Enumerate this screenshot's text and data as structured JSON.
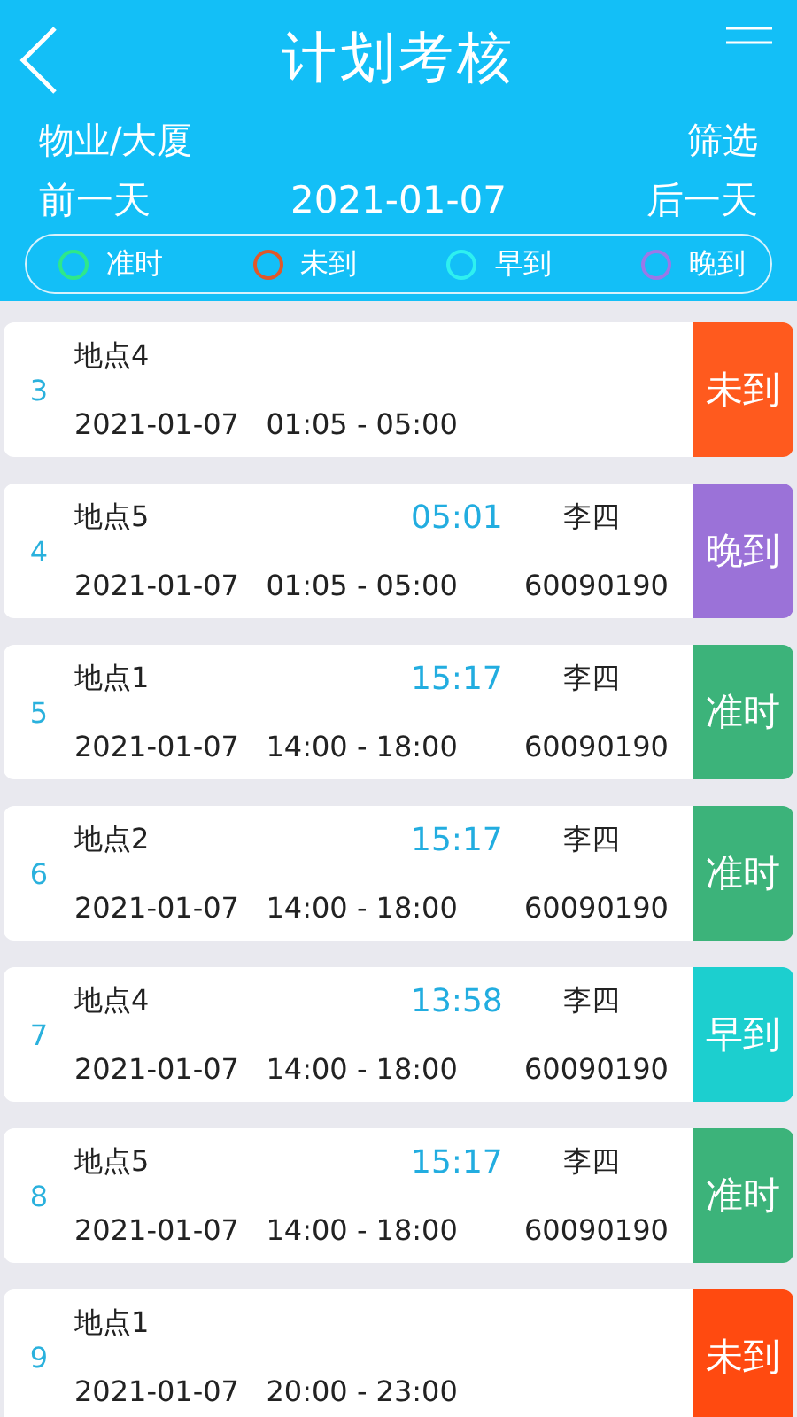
{
  "header": {
    "title": "计划考核",
    "location": "物业/大厦",
    "filter": "筛选",
    "prev_day": "前一天",
    "date": "2021-01-07",
    "next_day": "后一天"
  },
  "legend": [
    {
      "label": "准时",
      "color": "#2ee88a"
    },
    {
      "label": "未到",
      "color": "#e0582a"
    },
    {
      "label": "早到",
      "color": "#2ef0f0"
    },
    {
      "label": "晚到",
      "color": "#9a78e8"
    }
  ],
  "rows": [
    {
      "index": "3",
      "place": "地点4",
      "date": "2021-01-07",
      "range": "01:05 - 05:00",
      "status": "未到",
      "color": "#ff5a1e"
    },
    {
      "index": "4",
      "place": "地点5",
      "time": "05:01",
      "person": "李四",
      "id": "60090190",
      "date": "2021-01-07",
      "range": "01:05 - 05:00",
      "status": "晚到",
      "color": "#9b72d8"
    },
    {
      "index": "5",
      "place": "地点1",
      "time": "15:17",
      "person": "李四",
      "id": "60090190",
      "date": "2021-01-07",
      "range": "14:00 - 18:00",
      "status": "准时",
      "color": "#3cb37a"
    },
    {
      "index": "6",
      "place": "地点2",
      "time": "15:17",
      "person": "李四",
      "id": "60090190",
      "date": "2021-01-07",
      "range": "14:00 - 18:00",
      "status": "准时",
      "color": "#3cb37a"
    },
    {
      "index": "7",
      "place": "地点4",
      "time": "13:58",
      "person": "李四",
      "id": "60090190",
      "date": "2021-01-07",
      "range": "14:00 - 18:00",
      "status": "早到",
      "color": "#1ccfcf"
    },
    {
      "index": "8",
      "place": "地点5",
      "time": "15:17",
      "person": "李四",
      "id": "60090190",
      "date": "2021-01-07",
      "range": "14:00 - 18:00",
      "status": "准时",
      "color": "#3cb37a"
    },
    {
      "index": "9",
      "place": "地点1",
      "date": "2021-01-07",
      "range": "20:00 - 23:00",
      "status": "未到",
      "color": "#ff4a10"
    }
  ]
}
